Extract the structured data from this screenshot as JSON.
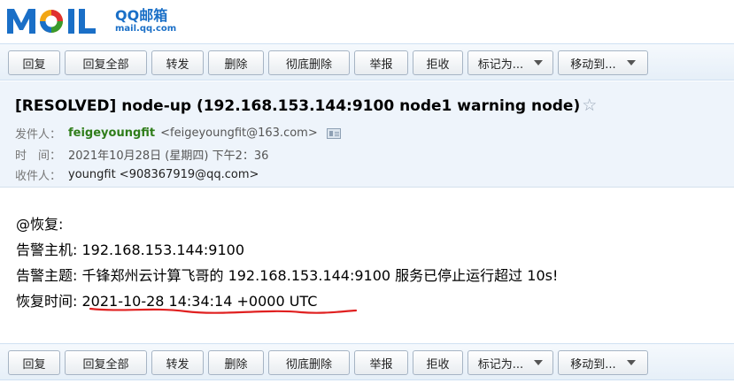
{
  "logo": {
    "mark": "MOIL",
    "cn": "QQ邮箱",
    "url": "mail.qq.com"
  },
  "toolbar": {
    "buttons": [
      {
        "label": "回复"
      },
      {
        "label": "回复全部"
      },
      {
        "label": "转发"
      },
      {
        "label": "删除"
      },
      {
        "label": "彻底删除"
      },
      {
        "label": "举报"
      },
      {
        "label": "拒收"
      },
      {
        "label": "标记为..."
      },
      {
        "label": "移动到..."
      }
    ]
  },
  "mail": {
    "subject": "[RESOLVED] node-up (192.168.153.144:9100 node1 warning node)",
    "star_icon": "☆",
    "from_label": "发件人：",
    "from_name": "feigeyoungfit",
    "from_addr": "<feigeyoungfit@163.com>",
    "time_label": "时　间：",
    "time_value": "2021年10月28日 (星期四) 下午2：36",
    "to_label": "收件人：",
    "to_value": "youngfit <908367919@qq.com>"
  },
  "body": {
    "lines": [
      "@恢复:",
      "告警主机:  192.168.153.144:9100",
      "告警主题:  千锋郑州云计算飞哥的 192.168.153.144:9100 服务已停止运行超过 10s!",
      "恢复时间:  2021-10-28 14:34:14 +0000 UTC"
    ]
  },
  "colors": {
    "accent": "#1a6fc7",
    "sender": "#2f7d1a",
    "underline": "#e02020",
    "panel": "#eef4fb"
  }
}
